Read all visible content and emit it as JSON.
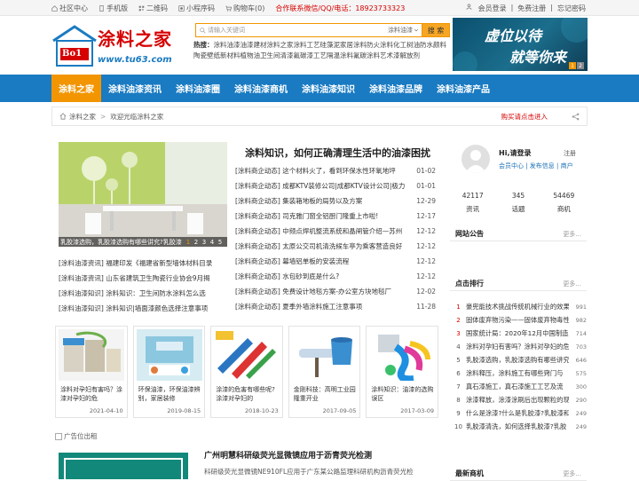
{
  "topbar": {
    "links": [
      {
        "label": "社区中心",
        "icon": "home-icon"
      },
      {
        "label": "手机版",
        "icon": "mobile-icon"
      },
      {
        "label": "二维码",
        "icon": "qrcode-icon"
      },
      {
        "label": "小程序码",
        "icon": "miniprogram-icon"
      },
      {
        "label": "购物车(0)",
        "icon": "cart-icon"
      }
    ],
    "hotline": "合作联系微信/QQ/电话：18923733323",
    "right": [
      "会员登录",
      "|",
      "免费注册",
      "|",
      "忘记密码"
    ]
  },
  "logo": {
    "title": "涂料之家",
    "badge": "Bo1",
    "url": "www.tu63.com"
  },
  "search": {
    "placeholder": "请输入关键词",
    "scope": "涂料油漆",
    "button": "搜 索"
  },
  "hotwords": {
    "label": "热搜：",
    "words": [
      "涂料油漆",
      "油漆",
      "建材",
      "涂料之家",
      "涂料工艺",
      "硅藻泥",
      "家居",
      "涂料",
      "防火涂料",
      "化工",
      "树油",
      "防水",
      "颜料",
      "陶瓷",
      "壁纸",
      "新材料",
      "植物油",
      "卫生间",
      "清漆",
      "氟碳漆",
      "工艺",
      "隔温",
      "涂料",
      "氟碳涂料",
      "艺术漆",
      "解放剂"
    ]
  },
  "banner": {
    "text_line1": "虚位以待",
    "text_line2": "就等你来",
    "dots": [
      "1",
      "2"
    ]
  },
  "nav": {
    "items": [
      "涂料之家",
      "涂料油漆资讯",
      "涂料油漆圈",
      "涂料油漆商机",
      "涂料油漆知识",
      "涂料油漆品牌",
      "涂料油漆产品"
    ]
  },
  "crumb": {
    "home": "涂料之家",
    "sep": ">",
    "current": "欢迎光临涂料之家",
    "ad": "购买请点击进入"
  },
  "focus": {
    "caption": "乳胶漆选购，乳胶漆选购有哪些讲究?乳胶漆",
    "nums": [
      "1",
      "2",
      "3",
      "4",
      "5"
    ]
  },
  "headline": "涂料知识，如何正确清理生活中的油漆困扰",
  "list1": [
    {
      "t": "[涂料商企动态] 这个材料火了，看到环保水性环氧地坪",
      "d": "01-02"
    },
    {
      "t": "[涂料商企动态] 成都KTV装修公司|成都KTV设计公司|极力",
      "d": "01-01"
    },
    {
      "t": "[涂料商企动态] 集装箱地板的局势以及方案",
      "d": "12-29"
    },
    {
      "t": "[涂料商企动态] 司克雅门窗全铝厨门隆重上市啦!",
      "d": "12-17"
    },
    {
      "t": "[涂料商企动态] 中频点焊机整流系统和晶闸管介绍—苏州",
      "d": "12-12"
    },
    {
      "t": "[涂料商企动态] 太原公交司机清洗候车亭为乘客营造良好",
      "d": "12-12"
    },
    {
      "t": "[涂料商企动态] 幕墙铝单板的安装流程",
      "d": "12-12"
    },
    {
      "t": "[涂料商企动态] 水包砂到底是什么?",
      "d": "12-12"
    },
    {
      "t": "[涂料商企动态] 免费设计地毯方案-办公室方块地毯厂",
      "d": "12-02"
    },
    {
      "t": "[涂料商企动态] 夏季外墙涂料施工注意事项",
      "d": "11-28"
    }
  ],
  "list2": [
    "[涂料油漆资讯] 福建印发《福建省新型墙体材料目录",
    "[涂料油漆资讯] 山东省建筑卫生陶瓷行业协会9月揭",
    "[涂料油漆知识] 涂料知识：卫生间防水涂料怎么选",
    "[涂料油漆知识] 涂料知识|墙面漆颜色选择注意事项"
  ],
  "thumbs": [
    {
      "t": "涂料对孕妇有害吗？涂漆对孕妇的危",
      "d": "2021-04-10",
      "icon": "paint-cans-image"
    },
    {
      "t": "环保油漆，环保油漆辨别，家居装修",
      "d": "2019-08-15",
      "icon": "eco-paint-image"
    },
    {
      "t": "涂漆的危害有哪些呢?涂漆对孕妇的",
      "d": "2018-10-23",
      "icon": "paint-brushes-image"
    },
    {
      "t": "金刚科技：高明工业园隆重开业",
      "d": "2017-09-05",
      "icon": "paint-roller-image"
    },
    {
      "t": "涂料知识：油漆的选购误区",
      "d": "2017-03-09",
      "icon": "color-splash-image"
    }
  ],
  "ad": {
    "text": "广告位出租"
  },
  "article": {
    "title": "广州明慧科研级荧光显微镜应用于沥青荧光检测",
    "desc": "科研级荧光显微镜NE910FL应用于广东某公路监理科研机构沥青荧光检"
  },
  "user": {
    "hi": "Hi,请登录",
    "reg": "注册",
    "links": "会员中心 | 发布信息 | 商户"
  },
  "stats": [
    {
      "n": "42117",
      "l": "资讯"
    },
    {
      "n": "345",
      "l": "话题"
    },
    {
      "n": "54469",
      "l": "商机"
    }
  ],
  "notice": {
    "title": "网站公告",
    "more": "更多..."
  },
  "rank": {
    "title": "点击排行",
    "more": "更多...",
    "items": [
      {
        "n": "1",
        "t": "豪兜能技术挑战传统机械行业的效果",
        "v": "991"
      },
      {
        "n": "2",
        "t": "固体废弃物污染——固体废弃物毒性",
        "v": "982"
      },
      {
        "n": "3",
        "t": "国家统计局：2020年12月中国制造业",
        "v": "714"
      },
      {
        "n": "4",
        "t": "涂料对孕妇有害吗？涂料对孕妇的危",
        "v": "703"
      },
      {
        "n": "5",
        "t": "乳胶漆选购，乳胶漆选购有哪些讲究",
        "v": "646"
      },
      {
        "n": "6",
        "t": "涂料释压，涂料施工有哪些窍门与",
        "v": "575"
      },
      {
        "n": "7",
        "t": "真石漆施工，真石漆施工工艺及流",
        "v": "300"
      },
      {
        "n": "8",
        "t": "涂漆释放，涂漆涂刷后出现颗粒的现",
        "v": "290"
      },
      {
        "n": "9",
        "t": "什么是涂漆?什么是乳胶漆?乳胶漆和",
        "v": "249"
      },
      {
        "n": "10",
        "t": "乳胶漆清洗，如何选择乳胶漆?乳胶",
        "v": "249"
      }
    ]
  },
  "newest": {
    "title": "最新商机",
    "more": "更多..."
  }
}
